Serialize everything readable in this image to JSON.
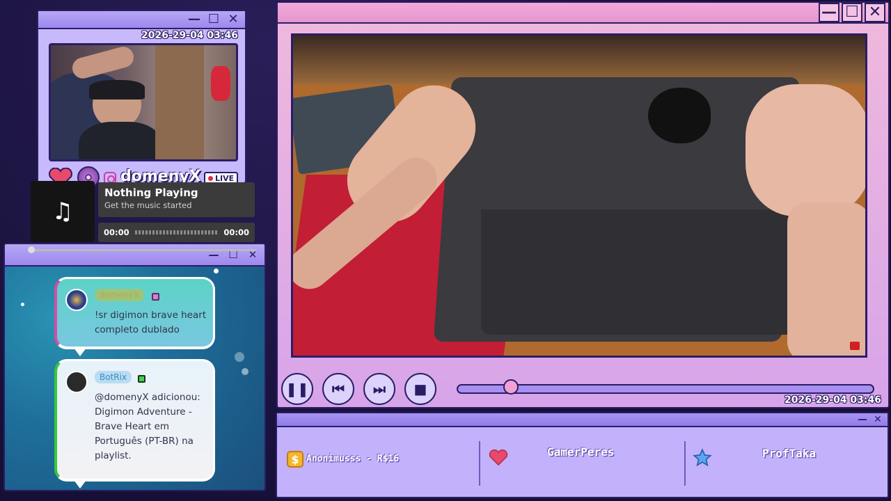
{
  "camera_window": {
    "timestamp": "2026-29-04 03:46",
    "channel_name": "domenyX",
    "live_label": "LIVE",
    "icons": [
      "heart-icon",
      "disc-icon",
      "instagram-icon"
    ],
    "window_controls": {
      "minimize": "—",
      "maximize": "☐",
      "close": "✕"
    }
  },
  "music_player": {
    "art_icon": "♫",
    "title": "Nothing Playing",
    "subtitle": "Get the music started",
    "time_elapsed": "00:00",
    "time_total": "00:00"
  },
  "chat": {
    "window_controls": {
      "minimize": "—",
      "maximize": "☐",
      "close": "✕"
    },
    "messages": [
      {
        "username": "domenyX",
        "text": "!sr digimon brave heart completo dublado",
        "accent_color": "#d24fa4"
      },
      {
        "username": "BotRix",
        "text": "@domenyX adicionou: Digimon Adventure - Brave Heart em Português (PT-BR) na playlist.",
        "accent_color": "#35c93a"
      }
    ]
  },
  "video_player": {
    "window_controls": {
      "minimize": "—",
      "maximize": "☐",
      "close": "✕"
    },
    "controls": {
      "pause": "❚❚",
      "previous": "⏮",
      "next": "⏭",
      "stop": "■"
    },
    "progress": 0.13,
    "timestamp": "2026-29-04 03:46"
  },
  "alerts_bar": {
    "window_controls": {
      "minimize": "—",
      "close": "✕"
    },
    "latest_donation": {
      "icon": "dollar-icon",
      "text": "Anonimusss - R$16"
    },
    "latest_follower": {
      "icon": "heart-icon",
      "text": "GamerPeres"
    },
    "latest_subscriber": {
      "icon": "star-icon",
      "text": "ProfTaka"
    }
  },
  "colors": {
    "frame": "#2b1d64",
    "window_purple": "#c3b1fb",
    "video_pink": "#f0b9dd",
    "seek_knob": "#f4a0d5"
  }
}
